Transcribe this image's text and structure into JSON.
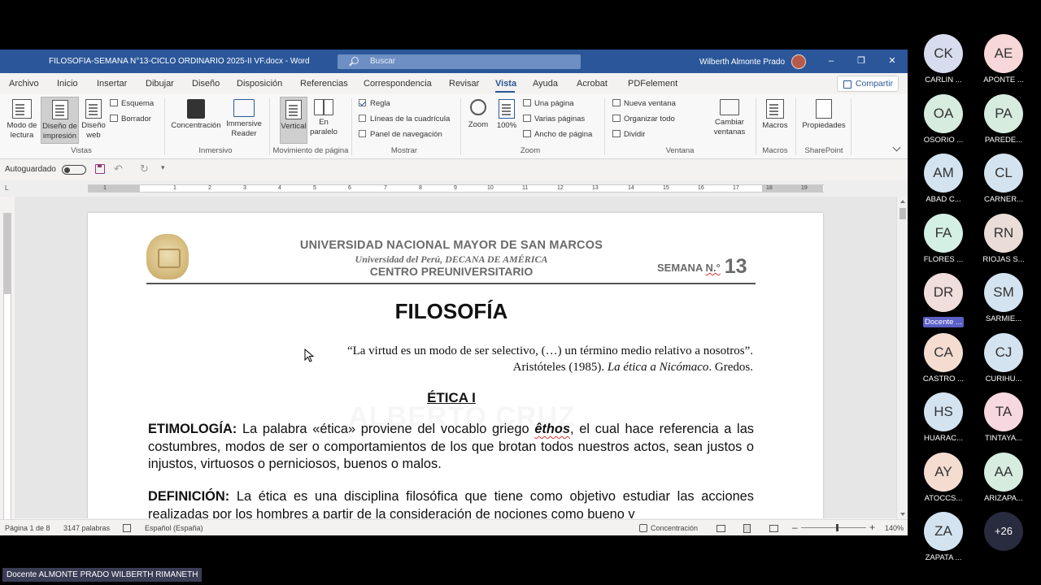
{
  "window": {
    "title": "FILOSOFIA-SEMANA N°13-CICLO ORDINARIO 2025-II VF.docx  -  Word",
    "search_placeholder": "Buscar",
    "user_name": "Wilberth Almonte Prado"
  },
  "menu": {
    "items": [
      "Archivo",
      "Inicio",
      "Insertar",
      "Dibujar",
      "Diseño",
      "Disposición",
      "Referencias",
      "Correspondencia",
      "Revisar",
      "Vista",
      "Ayuda",
      "Acrobat",
      "PDFelement"
    ],
    "active": "Vista",
    "share_label": "Compartir"
  },
  "ribbon": {
    "vistas": {
      "modo_lectura": "Modo de lectura",
      "diseno_impresion": "Diseño de impresión",
      "diseno_web": "Diseño web",
      "esquema": "Esquema",
      "borrador": "Borrador",
      "group": "Vistas"
    },
    "inmersivo": {
      "concentracion": "Concentración",
      "immersive_reader": "Immersive Reader",
      "group": "Inmersivo"
    },
    "movimiento": {
      "vertical": "Vertical",
      "en_paralelo": "En paralelo",
      "group": "Movimiento de página"
    },
    "mostrar": {
      "regla": "Regla",
      "regla_checked": true,
      "lineas": "Líneas de la cuadrícula",
      "panel": "Panel de navegación",
      "group": "Mostrar"
    },
    "zoom": {
      "zoom": "Zoom",
      "cien": "100%",
      "una_pagina": "Una página",
      "varias_paginas": "Varias páginas",
      "ancho_pagina": "Ancho de página",
      "group": "Zoom"
    },
    "ventana": {
      "nueva": "Nueva ventana",
      "organizar": "Organizar todo",
      "dividir": "Dividir",
      "cambiar": "Cambiar ventanas",
      "group": "Ventana"
    },
    "macros": {
      "macros": "Macros",
      "group": "Macros"
    },
    "sharepoint": {
      "propiedades": "Propiedades",
      "group": "SharePoint"
    }
  },
  "qat": {
    "autoguardado": "Autoguardado"
  },
  "ruler_ticks": [
    "1",
    "1",
    "2",
    "3",
    "4",
    "5",
    "6",
    "7",
    "8",
    "9",
    "10",
    "11",
    "12",
    "13",
    "14",
    "15",
    "16",
    "17",
    "18",
    "19"
  ],
  "document": {
    "university": "UNIVERSIDAD NACIONAL MAYOR DE SAN MARCOS",
    "subtitle": "Universidad del Perú, DECANA DE AMÉRICA",
    "center": "CENTRO PREUNIVERSITARIO",
    "semana_label": "SEMANA",
    "semana_no": "N.°",
    "semana_num": "13",
    "title": "FILOSOFÍA",
    "quote_line1": "“La virtud es un modo de ser selectivo, (…) un término medio relativo a nosotros”.",
    "quote_line2_a": "Aristóteles (1985). ",
    "quote_line2_b": "La ética a Nicómaco",
    "quote_line2_c": ". Gredos.",
    "section_title": "ÉTICA I",
    "watermark": "ALBERTO CRUZ",
    "etimologia_label": "ETIMOLOGÍA:",
    "etimologia_a": " La palabra «ética» proviene del vocablo griego ",
    "etimologia_word": "êthos",
    "etimologia_b": ", el cual hace referencia a las costumbres, modos de ser o comportamientos de los que brotan todos nuestros actos, sean justos o injustos, virtuosos o perniciosos, buenos o malos.",
    "definicion_label": "DEFINICIÓN:",
    "definicion_text": " La ética es una disciplina filosófica que tiene como objetivo estudiar las acciones realizadas por los hombres a partir de la consideración de nociones como bueno y"
  },
  "status": {
    "page": "Página 1 de 8",
    "words": "3147 palabras",
    "language": "Español (España)",
    "focus": "Concentración",
    "zoom": "140%"
  },
  "participants": [
    {
      "initials": "CK",
      "name": "CARLIN ...",
      "color": "#d8dcef"
    },
    {
      "initials": "AE",
      "name": "APONTE ...",
      "color": "#f7d7d7"
    },
    {
      "initials": "OA",
      "name": "OSORIO ...",
      "color": "#d6ecdf"
    },
    {
      "initials": "PA",
      "name": "PAREDE...",
      "color": "#d6ecdf"
    },
    {
      "initials": "AM",
      "name": "ABAD C...",
      "color": "#d4e3f0"
    },
    {
      "initials": "CL",
      "name": "CARNER...",
      "color": "#d4e3f0"
    },
    {
      "initials": "FA",
      "name": "FLORES ...",
      "color": "#d4efe3"
    },
    {
      "initials": "RN",
      "name": "RIOJAS S...",
      "color": "#eadcd7"
    },
    {
      "initials": "DR",
      "name": "Docente ...",
      "color": "#f0dedc",
      "highlight": true
    },
    {
      "initials": "SM",
      "name": "SARMIE...",
      "color": "#d4e3f0"
    },
    {
      "initials": "CA",
      "name": "CASTRO ...",
      "color": "#f4dcd1"
    },
    {
      "initials": "CJ",
      "name": "CURIHU...",
      "color": "#d4e3f0"
    },
    {
      "initials": "HS",
      "name": "HUARAC...",
      "color": "#d4e3f0"
    },
    {
      "initials": "TA",
      "name": "TINTAYA...",
      "color": "#f7d7e0"
    },
    {
      "initials": "AY",
      "name": "ATOCCS...",
      "color": "#f4dcd1"
    },
    {
      "initials": "AA",
      "name": "ARIZAPA...",
      "color": "#d6ecdf"
    },
    {
      "initials": "ZA",
      "name": "ZAPATA ...",
      "color": "#d4e3f0"
    },
    {
      "initials": "+26",
      "name": "",
      "color": "#292b3e",
      "more": true
    }
  ],
  "presenter_label": "Docente ALMONTE PRADO WILBERTH RIMANETH"
}
